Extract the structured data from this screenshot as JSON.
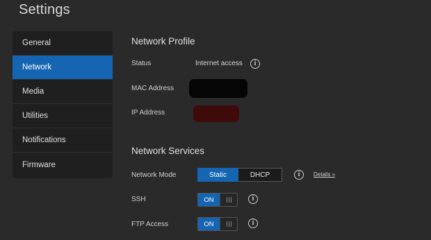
{
  "page": {
    "title": "Settings"
  },
  "sidebar": {
    "items": [
      {
        "label": "General",
        "active": false
      },
      {
        "label": "Network",
        "active": true
      },
      {
        "label": "Media",
        "active": false
      },
      {
        "label": "Utilities",
        "active": false
      },
      {
        "label": "Notifications",
        "active": false
      },
      {
        "label": "Firmware",
        "active": false
      }
    ]
  },
  "network_profile": {
    "title": "Network Profile",
    "status_label": "Status",
    "status_value": "Internet access",
    "mac_label": "MAC Address",
    "ip_label": "IP Address"
  },
  "network_services": {
    "title": "Network Services",
    "mode_label": "Network Mode",
    "mode_options": [
      "Static",
      "DHCP"
    ],
    "mode_selected": "Static",
    "details_link": "Details »",
    "ssh_label": "SSH",
    "ssh_state": "ON",
    "ftp_label": "FTP Access",
    "ftp_state": "ON"
  },
  "icons": {
    "info": "info-icon"
  },
  "colors": {
    "accent": "#1565b2",
    "background": "#2a2a2a",
    "sidebar_bg": "#1f1f1f"
  }
}
